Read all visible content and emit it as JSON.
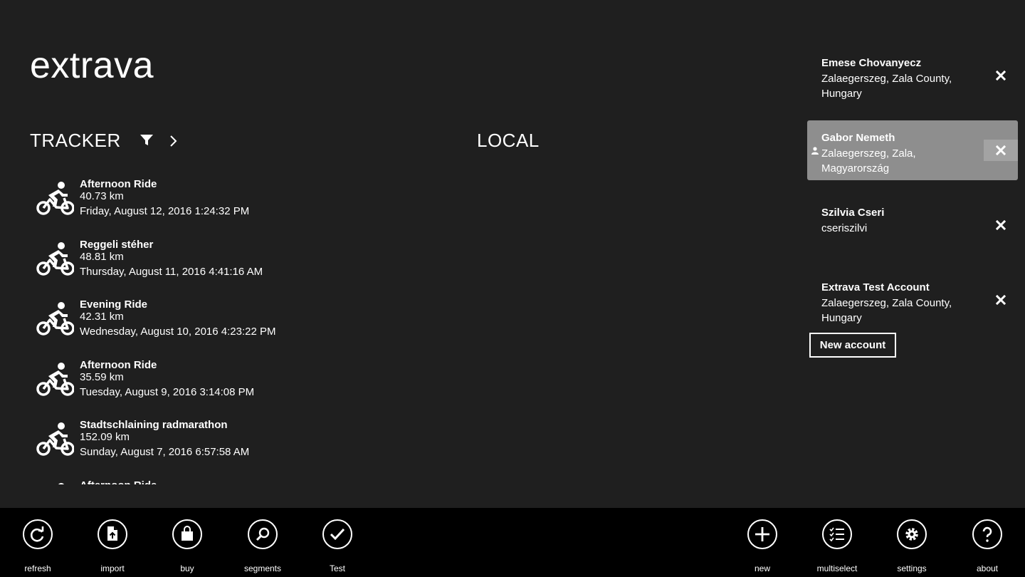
{
  "app": {
    "title": "extrava"
  },
  "tracker": {
    "header": "TRACKER",
    "activities": [
      {
        "name": "Afternoon Ride",
        "distance": "40.73 km",
        "date": "Friday, August 12, 2016 1:24:32 PM"
      },
      {
        "name": "Reggeli stéher",
        "distance": "48.81 km",
        "date": "Thursday, August 11, 2016 4:41:16 AM"
      },
      {
        "name": "Evening Ride",
        "distance": "42.31 km",
        "date": "Wednesday, August 10, 2016 4:23:22 PM"
      },
      {
        "name": "Afternoon Ride",
        "distance": "35.59 km",
        "date": "Tuesday, August 9, 2016 3:14:08 PM"
      },
      {
        "name": "Stadtschlaining radmarathon",
        "distance": "152.09 km",
        "date": "Sunday, August 7, 2016 6:57:58 AM"
      },
      {
        "name": "Afternoon Ride",
        "distance": "",
        "date": ""
      }
    ]
  },
  "local": {
    "header": "LOCAL"
  },
  "accounts": {
    "items": [
      {
        "name": "Emese Chovanyecz",
        "location": "Zalaegerszeg, Zala County, Hungary",
        "selected": false
      },
      {
        "name": "Gabor Nemeth",
        "location": "Zalaegerszeg, Zala, Magyarország",
        "selected": true
      },
      {
        "name": "Szilvia Cseri",
        "location": "cseriszilvi",
        "selected": false
      },
      {
        "name": "Extrava Test Account",
        "location": "Zalaegerszeg, Zala County, Hungary",
        "selected": false
      }
    ],
    "new_account_label": "New account"
  },
  "app_bar": {
    "left": [
      {
        "label": "refresh",
        "icon": "refresh-icon"
      },
      {
        "label": "import",
        "icon": "import-icon"
      },
      {
        "label": "buy",
        "icon": "bag-icon"
      },
      {
        "label": "segments",
        "icon": "search-icon"
      },
      {
        "label": "Test",
        "icon": "check-icon"
      }
    ],
    "right": [
      {
        "label": "new",
        "icon": "plus-icon"
      },
      {
        "label": "multiselect",
        "icon": "checklist-icon"
      },
      {
        "label": "settings",
        "icon": "gear-icon"
      },
      {
        "label": "about",
        "icon": "question-icon"
      }
    ]
  },
  "colors": {
    "background": "#1f1f1f",
    "app_bar": "#000000",
    "selected_account": "#8e8e8e",
    "text": "#ffffff"
  }
}
